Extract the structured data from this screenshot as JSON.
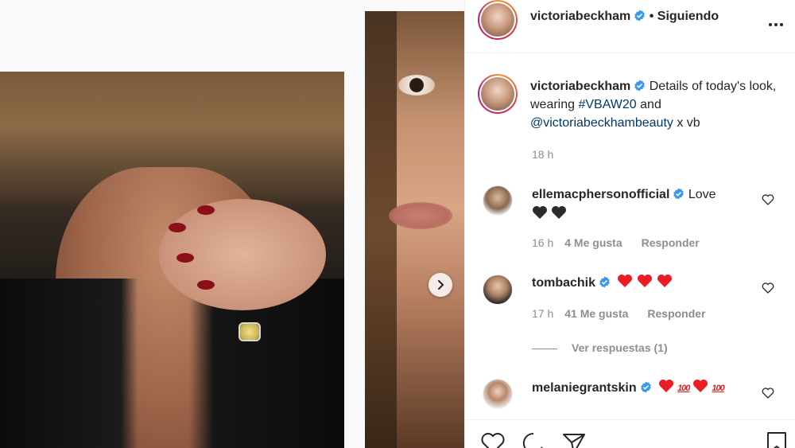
{
  "post": {
    "author": "victoriabeckham",
    "following_label": "• Siguiendo",
    "caption_text": "Details of today's look, wearing",
    "caption_hashtag": "#VBAW20",
    "caption_and": "and",
    "caption_mention": "@victoriabeckhambeauty",
    "caption_tail": "x vb",
    "caption_time": "18 h"
  },
  "comments": [
    {
      "user": "ellemacphersonofficial",
      "text": "Love",
      "time": "16 h",
      "likes": "4 Me gusta",
      "reply": "Responder"
    },
    {
      "user": "tombachik",
      "text": "",
      "time": "17 h",
      "likes": "41 Me gusta",
      "reply": "Responder",
      "view_replies": "Ver respuestas (1)"
    },
    {
      "user": "melaniegrantskin",
      "text": "",
      "hundred_badge": "100"
    }
  ],
  "colors": {
    "verified": "#3897f0",
    "link": "#00376b",
    "muted": "#8e8e8e",
    "heart": "#ed1c24"
  },
  "icons": [
    "verified-badge-icon",
    "more-options-icon",
    "heart-outline-icon",
    "comment-icon",
    "share-icon",
    "bookmark-icon",
    "chevron-right-icon"
  ]
}
